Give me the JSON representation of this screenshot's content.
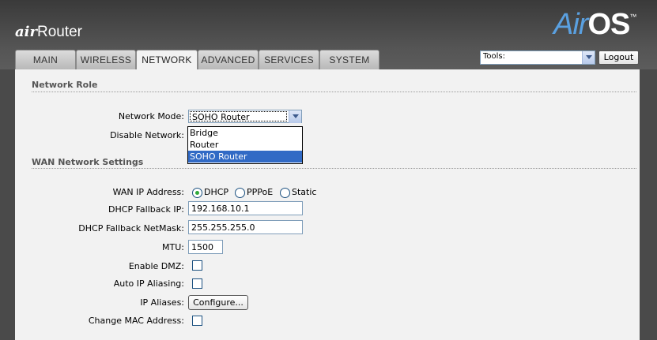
{
  "brand": {
    "air": "air",
    "router": "Router"
  },
  "logo": {
    "air": "Air",
    "os": "OS",
    "tm": "™"
  },
  "tabs": [
    "MAIN",
    "WIRELESS",
    "NETWORK",
    "ADVANCED",
    "SERVICES",
    "SYSTEM"
  ],
  "active_tab": "NETWORK",
  "tools": {
    "value": "Tools:"
  },
  "logout_label": "Logout",
  "network_role": {
    "title": "Network Role",
    "mode_label": "Network Mode:",
    "mode_value": "SOHO Router",
    "mode_options": [
      "Bridge",
      "Router",
      "SOHO Router"
    ],
    "disable_label": "Disable Network:"
  },
  "wan": {
    "title": "WAN Network Settings",
    "ip_label": "WAN IP Address:",
    "ip_options": [
      "DHCP",
      "PPPoE",
      "Static"
    ],
    "ip_selected": "DHCP",
    "fallback_ip_label": "DHCP Fallback IP:",
    "fallback_ip": "192.168.10.1",
    "fallback_mask_label": "DHCP Fallback NetMask:",
    "fallback_mask": "255.255.255.0",
    "mtu_label": "MTU:",
    "mtu": "1500",
    "dmz_label": "Enable DMZ:",
    "alias_auto_label": "Auto IP Aliasing:",
    "aliases_label": "IP Aliases:",
    "configure_label": "Configure...",
    "mac_label": "Change MAC Address:"
  },
  "colors": {
    "accent": "#316ac5",
    "logo_air": "#5aa0e0",
    "radio_on": "#2fa93a"
  }
}
